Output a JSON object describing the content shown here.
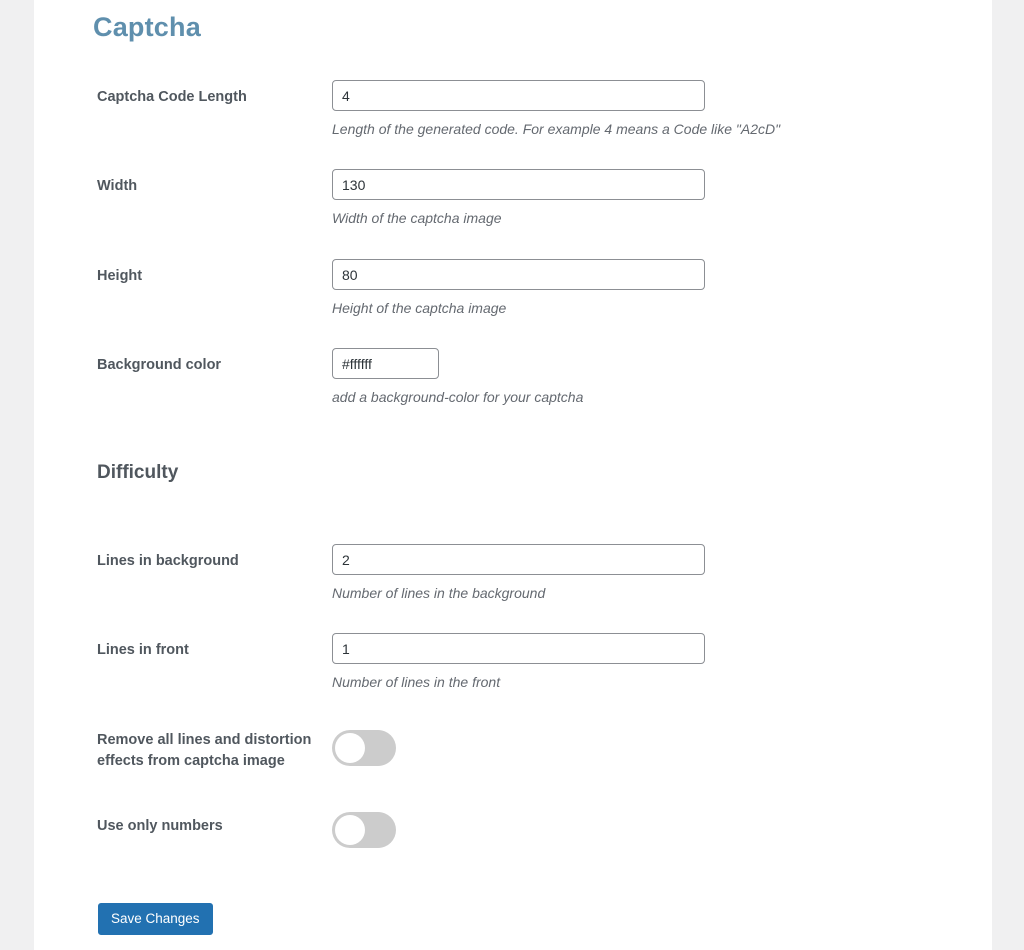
{
  "page": {
    "title": "Captcha"
  },
  "fields": {
    "code_length": {
      "label": "Captcha Code Length",
      "value": "4",
      "description": "Length of the generated code. For example 4 means a Code like \"A2cD\""
    },
    "width": {
      "label": "Width",
      "value": "130",
      "description": "Width of the captcha image"
    },
    "height": {
      "label": "Height",
      "value": "80",
      "description": "Height of the captcha image"
    },
    "background_color": {
      "label": "Background color",
      "value": "#ffffff",
      "description": "add a background-color for your captcha"
    }
  },
  "difficulty": {
    "title": "Difficulty",
    "lines_background": {
      "label": "Lines in background",
      "value": "2",
      "description": "Number of lines in the background"
    },
    "lines_front": {
      "label": "Lines in front",
      "value": "1",
      "description": "Number of lines in the front"
    },
    "remove_distortion": {
      "label": "Remove all lines and distortion effects from captcha image",
      "checked": false
    },
    "only_numbers": {
      "label": "Use only numbers",
      "checked": false
    }
  },
  "actions": {
    "save_label": "Save Changes"
  },
  "colors": {
    "title": "#5f8fad",
    "primary_button": "#2271b1",
    "toggle_off": "#cccccc"
  }
}
